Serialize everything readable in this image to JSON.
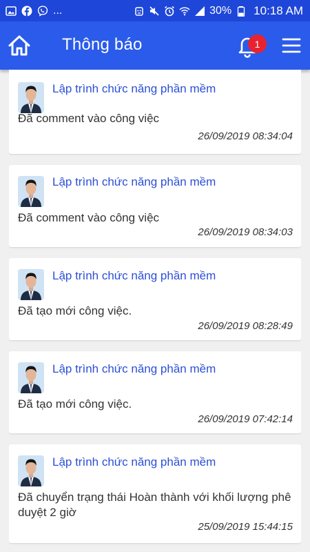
{
  "status_bar": {
    "left_icons": [
      "image-icon",
      "facebook-icon",
      "viber-icon"
    ],
    "more": "...",
    "battery": "30%",
    "time": "10:18 AM"
  },
  "header": {
    "title": "Thông báo",
    "notification_count": "1",
    "accent": "#2b5bea",
    "badge_color": "#e8232f"
  },
  "notifications": [
    {
      "title": "Lập trình chức năng phần mềm",
      "message": "Đã comment vào công việc",
      "time": "26/09/2019 08:34:04"
    },
    {
      "title": "Lập trình chức năng phần mềm",
      "message": "Đã comment vào công việc",
      "time": "26/09/2019 08:34:03"
    },
    {
      "title": "Lập trình chức năng phần mềm",
      "message": "Đã tạo mới công việc.",
      "time": "26/09/2019 08:28:49"
    },
    {
      "title": "Lập trình chức năng phần mềm",
      "message": "Đã tạo mới công việc.",
      "time": "26/09/2019 07:42:14"
    },
    {
      "title": "Lập trình chức năng phần mềm",
      "message": "Đã chuyển trạng thái Hoàn thành với khối lượng phê duyệt 2 giờ",
      "time": "25/09/2019 15:44:15"
    }
  ]
}
